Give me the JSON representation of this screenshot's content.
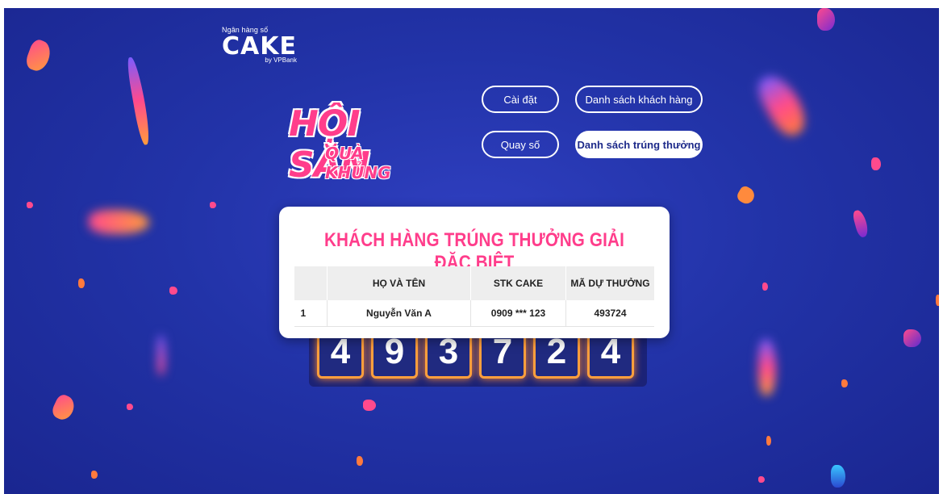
{
  "brand": {
    "bank_label": "Ngân hàng số",
    "name": "CAKE",
    "by": "by VPBank"
  },
  "campaign": {
    "line1": "HỘI SĂN",
    "line2": "QUÀ KHỦNG"
  },
  "nav": {
    "settings": "Cài đặt",
    "customer_list": "Danh sách khách hàng",
    "draw": "Quay số",
    "winner_list": "Danh sách trúng thưởng"
  },
  "result": {
    "title": "KHÁCH HÀNG TRÚNG THƯỞNG GIẢI ĐẶC BIỆT",
    "headers": [
      "",
      "HỌ VÀ TÊN",
      "STK CAKE",
      "MÃ DỰ THƯỞNG"
    ],
    "rows": [
      [
        "1",
        "Nguyễn Văn A",
        "0909 *** 123",
        "493724"
      ]
    ]
  },
  "board_digits": [
    "4",
    "9",
    "3",
    "7",
    "2",
    "4"
  ],
  "colors": {
    "background": "#2233a8",
    "accent_pink": "#ff3d8b",
    "digit_glow": "#ff9f3d"
  }
}
